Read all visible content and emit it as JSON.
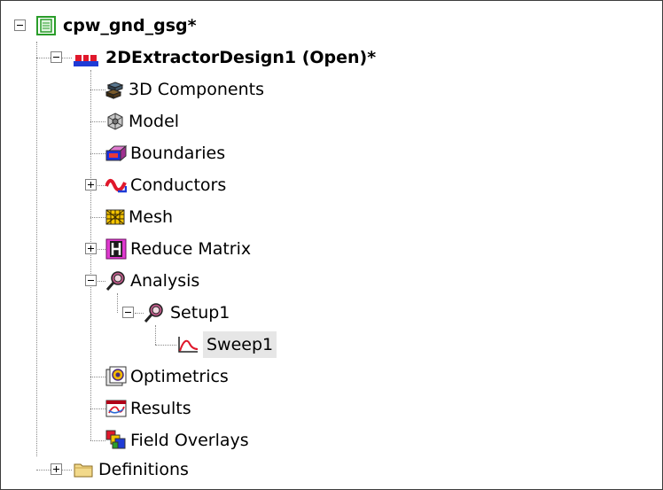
{
  "tree": {
    "root": {
      "label": "cpw_gnd_gsg*",
      "icon": "project-icon"
    },
    "design": {
      "label": "2DExtractorDesign1 (Open)*",
      "icon": "2d-extractor-design-icon"
    },
    "items": {
      "components_3d": {
        "label": "3D Components",
        "icon": "3d-components-icon"
      },
      "model": {
        "label": "Model",
        "icon": "model-icon"
      },
      "boundaries": {
        "label": "Boundaries",
        "icon": "boundaries-icon"
      },
      "conductors": {
        "label": "Conductors",
        "icon": "conductors-icon"
      },
      "mesh": {
        "label": "Mesh",
        "icon": "mesh-icon"
      },
      "reduce_matrix": {
        "label": "Reduce Matrix",
        "icon": "reduce-matrix-icon"
      },
      "analysis": {
        "label": "Analysis",
        "icon": "analysis-icon"
      },
      "setup1": {
        "label": "Setup1",
        "icon": "setup-icon"
      },
      "sweep1": {
        "label": "Sweep1",
        "icon": "sweep-icon"
      },
      "optimetrics": {
        "label": "Optimetrics",
        "icon": "optimetrics-icon"
      },
      "results": {
        "label": "Results",
        "icon": "results-icon"
      },
      "field_overlays": {
        "label": "Field Overlays",
        "icon": "field-overlays-icon"
      }
    },
    "definitions": {
      "label": "Definitions",
      "icon": "folder-icon"
    }
  }
}
